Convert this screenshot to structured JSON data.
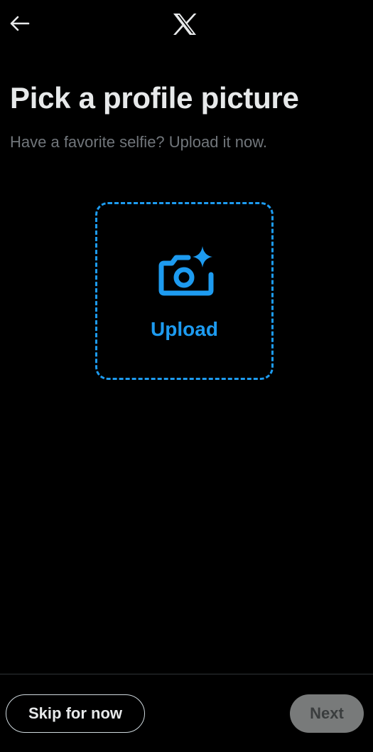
{
  "header": {
    "back_icon": "arrow-left-icon",
    "logo_icon": "x-logo-icon"
  },
  "main": {
    "title": "Pick a profile picture",
    "subtitle": "Have a favorite selfie? Upload it now.",
    "upload": {
      "icon": "camera-sparkle-icon",
      "label": "Upload"
    }
  },
  "footer": {
    "skip_label": "Skip for now",
    "next_label": "Next",
    "next_enabled": false
  },
  "colors": {
    "background": "#000000",
    "text_primary": "#e7e9ea",
    "text_secondary": "#71767b",
    "accent": "#1d9bf0",
    "next_disabled_bg": "#787a7a"
  }
}
